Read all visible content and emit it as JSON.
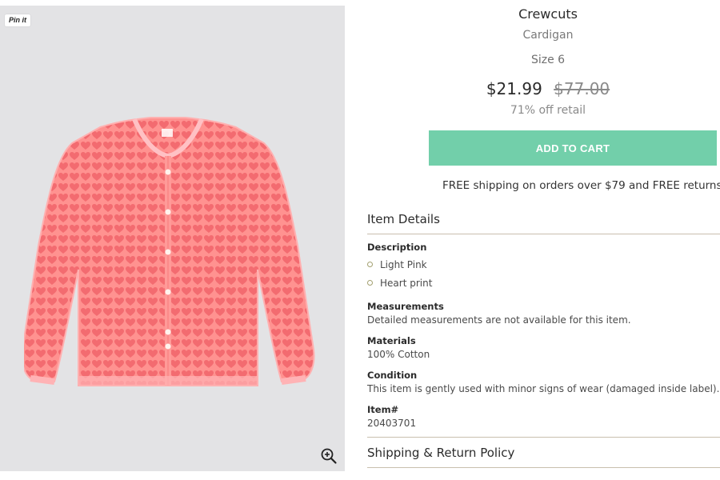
{
  "gallery": {
    "pin_label": "Pin it",
    "zoom_icon": "magnifier-plus-icon"
  },
  "product": {
    "brand": "Crewcuts",
    "category": "Cardigan",
    "size": "Size 6",
    "price": "$21.99",
    "retail_price": "$77.00",
    "discount_text": "71% off retail",
    "add_to_cart_label": "ADD TO CART",
    "shipping_note": "FREE shipping on orders over $79 and FREE returns"
  },
  "item_details": {
    "title": "Item Details",
    "description_label": "Description",
    "description_items": [
      "Light Pink",
      "Heart print"
    ],
    "measurements_label": "Measurements",
    "measurements_value": "Detailed measurements are not available for this item.",
    "materials_label": "Materials",
    "materials_value": "100% Cotton",
    "condition_label": "Condition",
    "condition_value": "This item is gently used with minor signs of wear (damaged inside label).",
    "item_number_label": "Item#",
    "item_number_value": "20403701"
  },
  "shipping_policy": {
    "title": "Shipping & Return Policy"
  },
  "colors": {
    "accent_button": "#72cfaa",
    "divider": "#c9bfae",
    "cardigan": "#ff8a8a",
    "heart": "#f56f73"
  }
}
